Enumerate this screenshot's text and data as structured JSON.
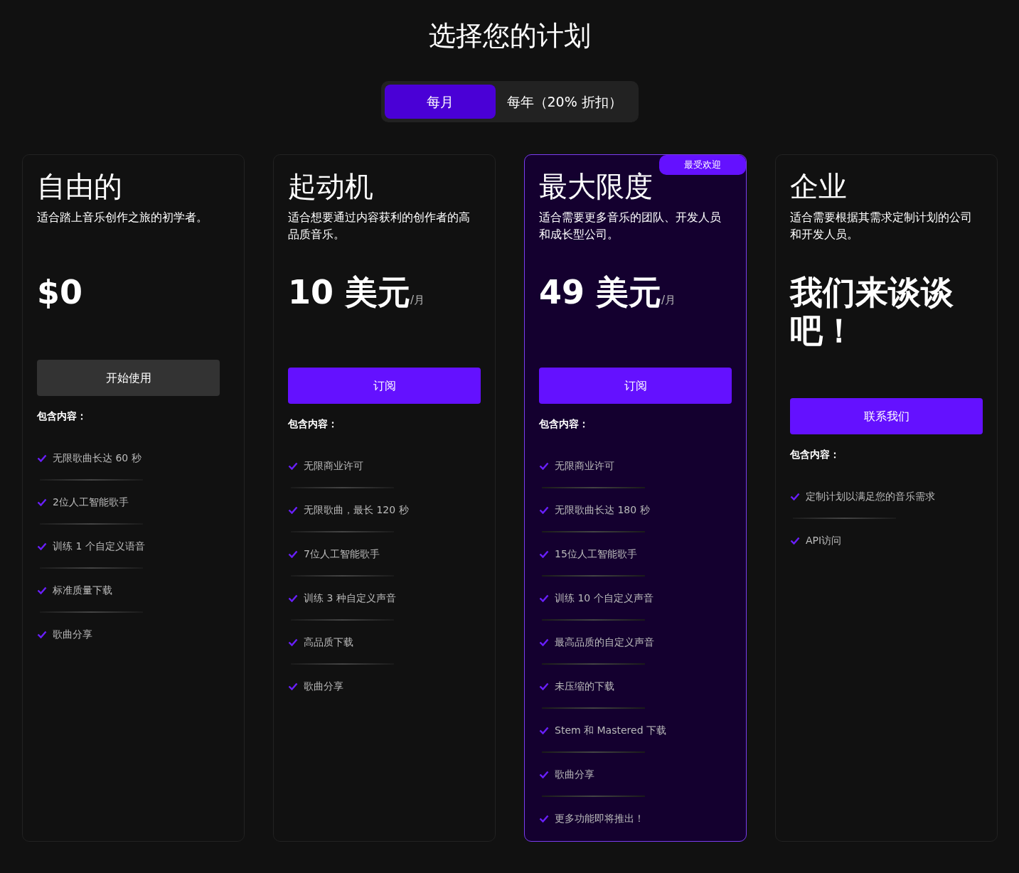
{
  "title": "选择您的计划",
  "billing_tabs": [
    {
      "label": "每月",
      "selected": true
    },
    {
      "label": "每年（20% 折扣）",
      "selected": false
    }
  ],
  "plans": [
    {
      "name": "自由的",
      "description": "适合踏上音乐创作之旅的初学者。",
      "price": "$0",
      "button": {
        "label": "开始使用",
        "kind": "secondary"
      },
      "includes_label": "包含内容：",
      "featured": false,
      "features": [
        "无限歌曲长达 60 秒",
        "2位人工智能歌手",
        "训练 1 个自定义语音",
        "标准质量下载",
        "歌曲分享"
      ]
    },
    {
      "name": "起动机",
      "description": "适合想要通过内容获利的创作者的高品质音乐。",
      "price": "10 美元",
      "period": "/月",
      "button": {
        "label": "订阅",
        "kind": "primary"
      },
      "includes_label": "包含内容：",
      "featured": false,
      "features": [
        "无限商业许可",
        "无限歌曲，最长 120 秒",
        "7位人工智能歌手",
        "训练 3 种自定义声音",
        "高品质下载",
        "歌曲分享"
      ]
    },
    {
      "name": "最大限度",
      "badge": "最受欢迎",
      "description": "适合需要更多音乐的团队、开发人员和成长型公司。",
      "price": "49 美元",
      "period": "/月",
      "button": {
        "label": "订阅",
        "kind": "primary"
      },
      "includes_label": "包含内容：",
      "featured": true,
      "features": [
        "无限商业许可",
        "无限歌曲长达 180 秒",
        "15位人工智能歌手",
        "训练 10 个自定义声音",
        "最高品质的自定义声音",
        "未压缩的下载",
        "Stem 和 Mastered 下载",
        "歌曲分享",
        "更多功能即将推出！"
      ]
    },
    {
      "name": "企业",
      "description": "适合需要根据其需求定制计划的公司和开发人员。",
      "price": "我们来谈谈吧！",
      "button": {
        "label": "联系我们",
        "kind": "primary"
      },
      "includes_label": "包含内容：",
      "featured": false,
      "features": [
        "定制计划以满足您的音乐需求",
        "API访问"
      ]
    }
  ]
}
